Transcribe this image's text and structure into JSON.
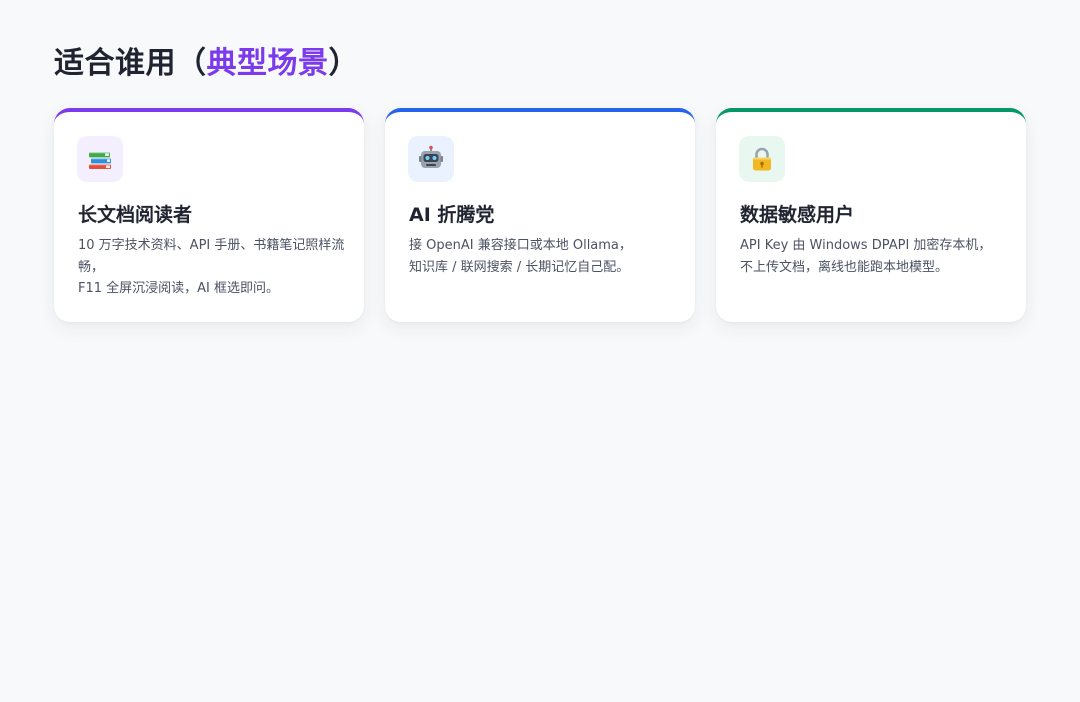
{
  "section": {
    "title_prefix": "适合谁用（",
    "title_accent": "典型场景",
    "title_suffix": "）"
  },
  "colors": {
    "title_accent": "#7c3aed",
    "card_accents": [
      "#7c3aed",
      "#2563eb",
      "#059669"
    ]
  },
  "cards": [
    {
      "icon": "books-icon",
      "title": "长文档阅读者",
      "desc_lines": [
        "10 万字技术资料、API 手册、书籍笔记照样流畅，",
        "F11 全屏沉浸阅读，AI 框选即问。"
      ]
    },
    {
      "icon": "robot-icon",
      "title": "AI 折腾党",
      "desc_lines": [
        "接 OpenAI 兼容接口或本地 Ollama，",
        "知识库 / 联网搜索 / 长期记忆自己配。"
      ]
    },
    {
      "icon": "lock-icon",
      "title": "数据敏感用户",
      "desc_lines": [
        "API Key 由 Windows DPAPI 加密存本机，",
        "不上传文档，离线也能跑本地模型。"
      ]
    }
  ]
}
